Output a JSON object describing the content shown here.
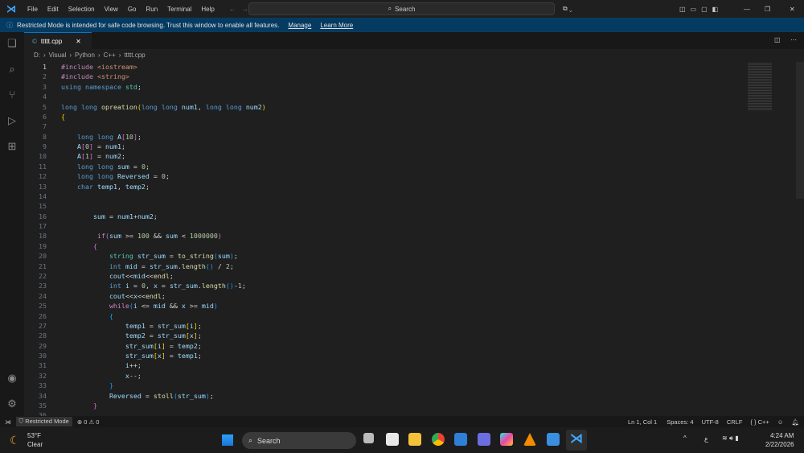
{
  "menu": [
    "File",
    "Edit",
    "Selection",
    "View",
    "Go",
    "Run",
    "Terminal",
    "Help"
  ],
  "search_label": "Search",
  "banner": {
    "text": "Restricted Mode is intended for safe code browsing. Trust this window to enable all features.",
    "manage": "Manage",
    "learn_more": "Learn More"
  },
  "tab": {
    "name": "ttttt.cpp"
  },
  "breadcrumbs": [
    "D:",
    "Visual",
    "Python",
    "C++",
    "ttttt.cpp"
  ],
  "code": [
    [
      [
        "#include ",
        "pp"
      ],
      [
        "<iostream>",
        "str"
      ]
    ],
    [
      [
        "#include ",
        "pp"
      ],
      [
        "<string>",
        "str"
      ]
    ],
    [
      [
        "using ",
        "kw"
      ],
      [
        "namespace ",
        "kw"
      ],
      [
        "std",
        "ns"
      ],
      [
        ";",
        "pl"
      ]
    ],
    [],
    [
      [
        "long long ",
        "kw"
      ],
      [
        "opreation",
        "fn"
      ],
      [
        "(",
        "b1"
      ],
      [
        "long long ",
        "kw"
      ],
      [
        "num1",
        "var"
      ],
      [
        ", ",
        "pl"
      ],
      [
        "long long ",
        "kw"
      ],
      [
        "num2",
        "var"
      ],
      [
        ")",
        "b1"
      ]
    ],
    [
      [
        "{",
        "b1"
      ]
    ],
    [],
    [
      [
        "    long long ",
        "kw"
      ],
      [
        "A",
        "var"
      ],
      [
        "[",
        "b2"
      ],
      [
        "10",
        "num"
      ],
      [
        "]",
        "b2"
      ],
      [
        ";",
        "pl"
      ]
    ],
    [
      [
        "    A",
        "var"
      ],
      [
        "[",
        "b2"
      ],
      [
        "0",
        "num"
      ],
      [
        "]",
        "b2"
      ],
      [
        " = ",
        "pl"
      ],
      [
        "num1",
        "var"
      ],
      [
        ";",
        "pl"
      ]
    ],
    [
      [
        "    A",
        "var"
      ],
      [
        "[",
        "b2"
      ],
      [
        "1",
        "num"
      ],
      [
        "]",
        "b2"
      ],
      [
        " = ",
        "pl"
      ],
      [
        "num2",
        "var"
      ],
      [
        ";",
        "pl"
      ]
    ],
    [
      [
        "    long long ",
        "kw"
      ],
      [
        "sum",
        "var"
      ],
      [
        " = ",
        "pl"
      ],
      [
        "0",
        "num"
      ],
      [
        ";",
        "pl"
      ]
    ],
    [
      [
        "    long long ",
        "kw"
      ],
      [
        "Reversed",
        "var"
      ],
      [
        " = ",
        "pl"
      ],
      [
        "0",
        "num"
      ],
      [
        ";",
        "pl"
      ]
    ],
    [
      [
        "    char ",
        "kw"
      ],
      [
        "temp1",
        "var"
      ],
      [
        ", ",
        "pl"
      ],
      [
        "temp2",
        "var"
      ],
      [
        ";",
        "pl"
      ]
    ],
    [],
    [],
    [
      [
        "        sum",
        "var"
      ],
      [
        " = ",
        "pl"
      ],
      [
        "num1",
        "var"
      ],
      [
        "+",
        "pl"
      ],
      [
        "num2",
        "var"
      ],
      [
        ";",
        "pl"
      ]
    ],
    [],
    [
      [
        "         if",
        "ctl"
      ],
      [
        "(",
        "b2"
      ],
      [
        "sum",
        "var"
      ],
      [
        " >= ",
        "pl"
      ],
      [
        "100",
        "num"
      ],
      [
        " && ",
        "pl"
      ],
      [
        "sum",
        "var"
      ],
      [
        " < ",
        "pl"
      ],
      [
        "1000000",
        "num"
      ],
      [
        ")",
        "b2"
      ]
    ],
    [
      [
        "        {",
        "b2"
      ]
    ],
    [
      [
        "            string ",
        "ns"
      ],
      [
        "str_sum",
        "var"
      ],
      [
        " = ",
        "pl"
      ],
      [
        "to_string",
        "fn"
      ],
      [
        "(",
        "b3"
      ],
      [
        "sum",
        "var"
      ],
      [
        ")",
        "b3"
      ],
      [
        ";",
        "pl"
      ]
    ],
    [
      [
        "            int ",
        "kw"
      ],
      [
        "mid",
        "var"
      ],
      [
        " = ",
        "pl"
      ],
      [
        "str_sum",
        "var"
      ],
      [
        ".",
        "pl"
      ],
      [
        "length",
        "fn"
      ],
      [
        "()",
        "b3"
      ],
      [
        " / ",
        "pl"
      ],
      [
        "2",
        "num"
      ],
      [
        ";",
        "pl"
      ]
    ],
    [
      [
        "            cout",
        "var"
      ],
      [
        "<<",
        "pl"
      ],
      [
        "mid",
        "var"
      ],
      [
        "<<",
        "pl"
      ],
      [
        "endl",
        "fn"
      ],
      [
        ";",
        "pl"
      ]
    ],
    [
      [
        "            int ",
        "kw"
      ],
      [
        "i",
        "var"
      ],
      [
        " = ",
        "pl"
      ],
      [
        "0",
        "num"
      ],
      [
        ", ",
        "pl"
      ],
      [
        "x",
        "var"
      ],
      [
        " = ",
        "pl"
      ],
      [
        "str_sum",
        "var"
      ],
      [
        ".",
        "pl"
      ],
      [
        "length",
        "fn"
      ],
      [
        "()",
        "b3"
      ],
      [
        "-",
        "pl"
      ],
      [
        "1",
        "num"
      ],
      [
        ";",
        "pl"
      ]
    ],
    [
      [
        "            cout",
        "var"
      ],
      [
        "<<",
        "pl"
      ],
      [
        "x",
        "var"
      ],
      [
        "<<",
        "pl"
      ],
      [
        "endl",
        "fn"
      ],
      [
        ";",
        "pl"
      ]
    ],
    [
      [
        "            while",
        "ctl"
      ],
      [
        "(",
        "b3"
      ],
      [
        "i",
        "var"
      ],
      [
        " <= ",
        "pl"
      ],
      [
        "mid",
        "var"
      ],
      [
        " && ",
        "pl"
      ],
      [
        "x",
        "var"
      ],
      [
        " >= ",
        "pl"
      ],
      [
        "mid",
        "var"
      ],
      [
        ")",
        "b3"
      ]
    ],
    [
      [
        "            {",
        "b3"
      ]
    ],
    [
      [
        "                temp1",
        "var"
      ],
      [
        " = ",
        "pl"
      ],
      [
        "str_sum",
        "var"
      ],
      [
        "[",
        "b1"
      ],
      [
        "i",
        "var"
      ],
      [
        "]",
        "b1"
      ],
      [
        ";",
        "pl"
      ]
    ],
    [
      [
        "                temp2",
        "var"
      ],
      [
        " = ",
        "pl"
      ],
      [
        "str_sum",
        "var"
      ],
      [
        "[",
        "b1"
      ],
      [
        "x",
        "var"
      ],
      [
        "]",
        "b1"
      ],
      [
        ";",
        "pl"
      ]
    ],
    [
      [
        "                str_sum",
        "var"
      ],
      [
        "[",
        "b1"
      ],
      [
        "i",
        "var"
      ],
      [
        "]",
        "b1"
      ],
      [
        " = ",
        "pl"
      ],
      [
        "temp2",
        "var"
      ],
      [
        ";",
        "pl"
      ]
    ],
    [
      [
        "                str_sum",
        "var"
      ],
      [
        "[",
        "b1"
      ],
      [
        "x",
        "var"
      ],
      [
        "]",
        "b1"
      ],
      [
        " = ",
        "pl"
      ],
      [
        "temp1",
        "var"
      ],
      [
        ";",
        "pl"
      ]
    ],
    [
      [
        "                i",
        "var"
      ],
      [
        "++;",
        "pl"
      ]
    ],
    [
      [
        "                x",
        "var"
      ],
      [
        "--;",
        "pl"
      ]
    ],
    [
      [
        "            }",
        "b3"
      ]
    ],
    [
      [
        "            Reversed",
        "var"
      ],
      [
        " = ",
        "pl"
      ],
      [
        "stoll",
        "fn"
      ],
      [
        "(",
        "b3"
      ],
      [
        "str_sum",
        "var"
      ],
      [
        ")",
        "b3"
      ],
      [
        ";",
        "pl"
      ]
    ],
    [
      [
        "        }",
        "b2"
      ]
    ],
    []
  ],
  "status": {
    "restricted": "Restricted Mode",
    "errors": "0",
    "warnings": "0",
    "position": "Ln 1, Col 1",
    "spaces": "Spaces: 4",
    "encoding": "UTF-8",
    "eol": "CRLF",
    "language": "C++"
  },
  "taskbar": {
    "temp": "53°F",
    "weather": "Clear",
    "search": "Search",
    "time": "4:24 AM",
    "date": "2/22/2026",
    "ime": "ع"
  }
}
